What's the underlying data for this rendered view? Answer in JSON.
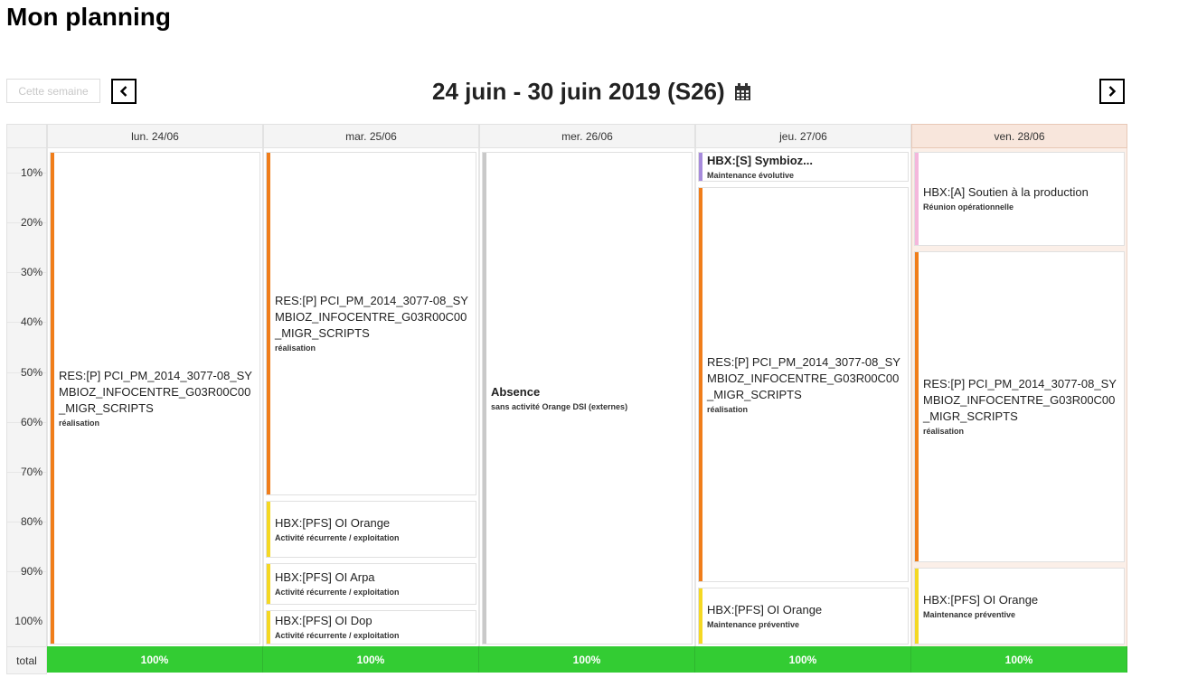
{
  "page": {
    "title": "Mon planning"
  },
  "nav": {
    "this_week_label": "Cette semaine",
    "week_range": "24 juin - 30 juin 2019 (S26)",
    "prev_icon": "chevron-left-icon",
    "next_icon": "chevron-right-icon",
    "calendar_icon": "calendar-icon"
  },
  "axis": {
    "labels": [
      "10%",
      "20%",
      "30%",
      "40%",
      "50%",
      "60%",
      "70%",
      "80%",
      "90%",
      "100%"
    ],
    "total_label": "total"
  },
  "colors": {
    "res_bar": "#f07d1a",
    "pfs_bar": "#f5d823",
    "absence_bar": "#c9c9c9",
    "evolutive_bar": "#a78bdc",
    "prod_bar": "#f4b7dc",
    "total_bg": "#33cc33",
    "today_header": "#f8e6dc"
  },
  "days": [
    {
      "label": "lun. 24/06",
      "today": false,
      "total": "100%",
      "events": [
        {
          "title": "RES:[P] PCI_PM_2014_3077-08_SYMBIOZ_INFOCENTRE_G03R00C00_MIGR_SCRIPTS",
          "subtitle": "réalisation",
          "start": 0,
          "end": 100,
          "color": "#f07d1a",
          "bold": false
        }
      ]
    },
    {
      "label": "mar. 25/06",
      "today": false,
      "total": "100%",
      "events": [
        {
          "title": "RES:[P] PCI_PM_2014_3077-08_SYMBIOZ_INFOCENTRE_G03R00C00_MIGR_SCRIPTS",
          "subtitle": "réalisation",
          "start": 0,
          "end": 70,
          "color": "#f07d1a",
          "bold": false
        },
        {
          "title": "HBX:[PFS] OI Orange",
          "subtitle": "Activité récurrente / exploitation",
          "start": 70,
          "end": 82.5,
          "color": "#f5d823",
          "bold": false
        },
        {
          "title": "HBX:[PFS] OI Arpa",
          "subtitle": "Activité récurrente / exploitation",
          "start": 82.5,
          "end": 92,
          "color": "#f5d823",
          "bold": false
        },
        {
          "title": "HBX:[PFS] OI Dop",
          "subtitle": "Activité récurrente / exploitation",
          "start": 92,
          "end": 100,
          "color": "#f5d823",
          "bold": false
        }
      ]
    },
    {
      "label": "mer. 26/06",
      "today": false,
      "total": "100%",
      "events": [
        {
          "title": "Absence",
          "subtitle": "sans activité Orange DSI (externes)",
          "start": 0,
          "end": 100,
          "color": "#c9c9c9",
          "bold": true
        }
      ]
    },
    {
      "label": "jeu. 27/06",
      "today": false,
      "total": "100%",
      "events": [
        {
          "title": "HBX:[S] Symbioz...",
          "subtitle": "Maintenance évolutive",
          "start": 0,
          "end": 7,
          "color": "#a78bdc",
          "bold": true
        },
        {
          "title": "RES:[P] PCI_PM_2014_3077-08_SYMBIOZ_INFOCENTRE_G03R00C00_MIGR_SCRIPTS",
          "subtitle": "réalisation",
          "start": 7,
          "end": 87.5,
          "color": "#f07d1a",
          "bold": false
        },
        {
          "title": "HBX:[PFS] OI Orange",
          "subtitle": "Maintenance préventive",
          "start": 87.5,
          "end": 100,
          "color": "#f5d823",
          "bold": false
        }
      ]
    },
    {
      "label": "ven. 28/06",
      "today": true,
      "total": "100%",
      "events": [
        {
          "title": "HBX:[A] Soutien à la production",
          "subtitle": "Réunion opérationnelle",
          "start": 0,
          "end": 20,
          "color": "#f4b7dc",
          "bold": false
        },
        {
          "title": "RES:[P] PCI_PM_2014_3077-08_SYMBIOZ_INFOCENTRE_G03R00C00_MIGR_SCRIPTS",
          "subtitle": "réalisation",
          "start": 20,
          "end": 83.5,
          "color": "#f07d1a",
          "bold": false
        },
        {
          "title": "HBX:[PFS] OI Orange",
          "subtitle": "Maintenance préventive",
          "start": 83.5,
          "end": 100,
          "color": "#f5d823",
          "bold": false
        }
      ]
    }
  ]
}
